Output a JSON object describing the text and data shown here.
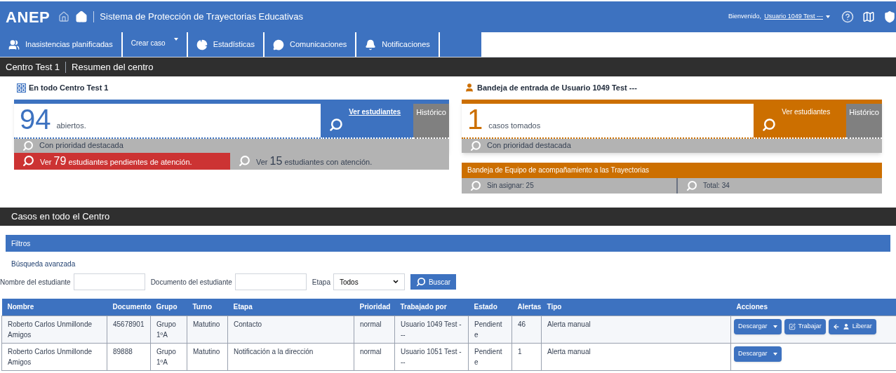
{
  "header": {
    "logo": "ANEP",
    "title": "Sistema de Protección de Trayectorias Educativas",
    "welcome": "Bienvenido,",
    "user": "Usuario 1049 Test ---"
  },
  "nav": [
    {
      "label": "Inasistencias planificadas",
      "kind": "link"
    },
    {
      "label": "Crear caso",
      "kind": "dropdown"
    },
    {
      "label": "Estadísticas",
      "kind": "link"
    },
    {
      "label": "Comunicaciones",
      "kind": "link"
    },
    {
      "label": "Notificaciones",
      "kind": "link"
    }
  ],
  "breadcrumb": [
    "Centro Test 1",
    "Resumen del centro"
  ],
  "centro_panel": {
    "title": "En todo Centro Test 1",
    "count": "94",
    "count_label": "abiertos.",
    "view_link": "Ver estudiantes",
    "history": "Histórico",
    "priority": "Con prioridad destacada",
    "pending": {
      "prefix": "Ver",
      "number": "79",
      "suffix": "estudiantes pendientes de atención."
    },
    "attended": {
      "prefix": "Ver",
      "number": "15",
      "suffix": "estudiantes con atención."
    }
  },
  "bandeja_panel": {
    "title": "Bandeja de entrada de Usuario 1049 Test ---",
    "count": "1",
    "count_label": "casos tomados",
    "view_link": "Ver estudiantes",
    "history": "Histórico",
    "priority": "Con prioridad destacada",
    "team_title": "Bandeja de Equipo de acompañamiento a las Trayectorias",
    "unassigned": "Sin asignar: 25",
    "total": "Total: 34"
  },
  "cases_title": "Casos en todo el Centro",
  "filters": {
    "title": "Filtros",
    "advanced": "Búsqueda avanzada",
    "name_label": "Nombre del estudiante",
    "document_label": "Documento del estudiante",
    "stage_label": "Etapa",
    "stage_value": "Todos",
    "search_button": "Buscar"
  },
  "table": {
    "columns": [
      "Nombre",
      "Documento",
      "Grupo",
      "Turno",
      "Etapa",
      "Prioridad",
      "Trabajado por",
      "Estado",
      "Alertas",
      "Tipo",
      "Acciones"
    ],
    "rows": [
      {
        "cells": [
          "Roberto Carlos Unmillonde Amigos",
          "45678901",
          "Grupo 1ºA",
          "Matutino",
          "Contacto",
          "normal",
          "Usuario 1049 Test ---",
          "Pendiente",
          "46",
          "Alerta manual"
        ],
        "actions": [
          {
            "label": "Descargar",
            "kind": "dropdown"
          },
          {
            "label": "Trabajar",
            "kind": "edit"
          },
          {
            "label": "Liberar",
            "kind": "release"
          }
        ]
      },
      {
        "cells": [
          "Roberto Carlos Unmillonde Amigos",
          "89888",
          "Grupo 1ºA",
          "Matutino",
          "Notificación a la dirección",
          "normal",
          "Usuario 1051 Test ---",
          "Pendiente",
          "1",
          "Alerta manual"
        ],
        "actions": [
          {
            "label": "Descargar",
            "kind": "dropdown"
          }
        ]
      }
    ]
  }
}
